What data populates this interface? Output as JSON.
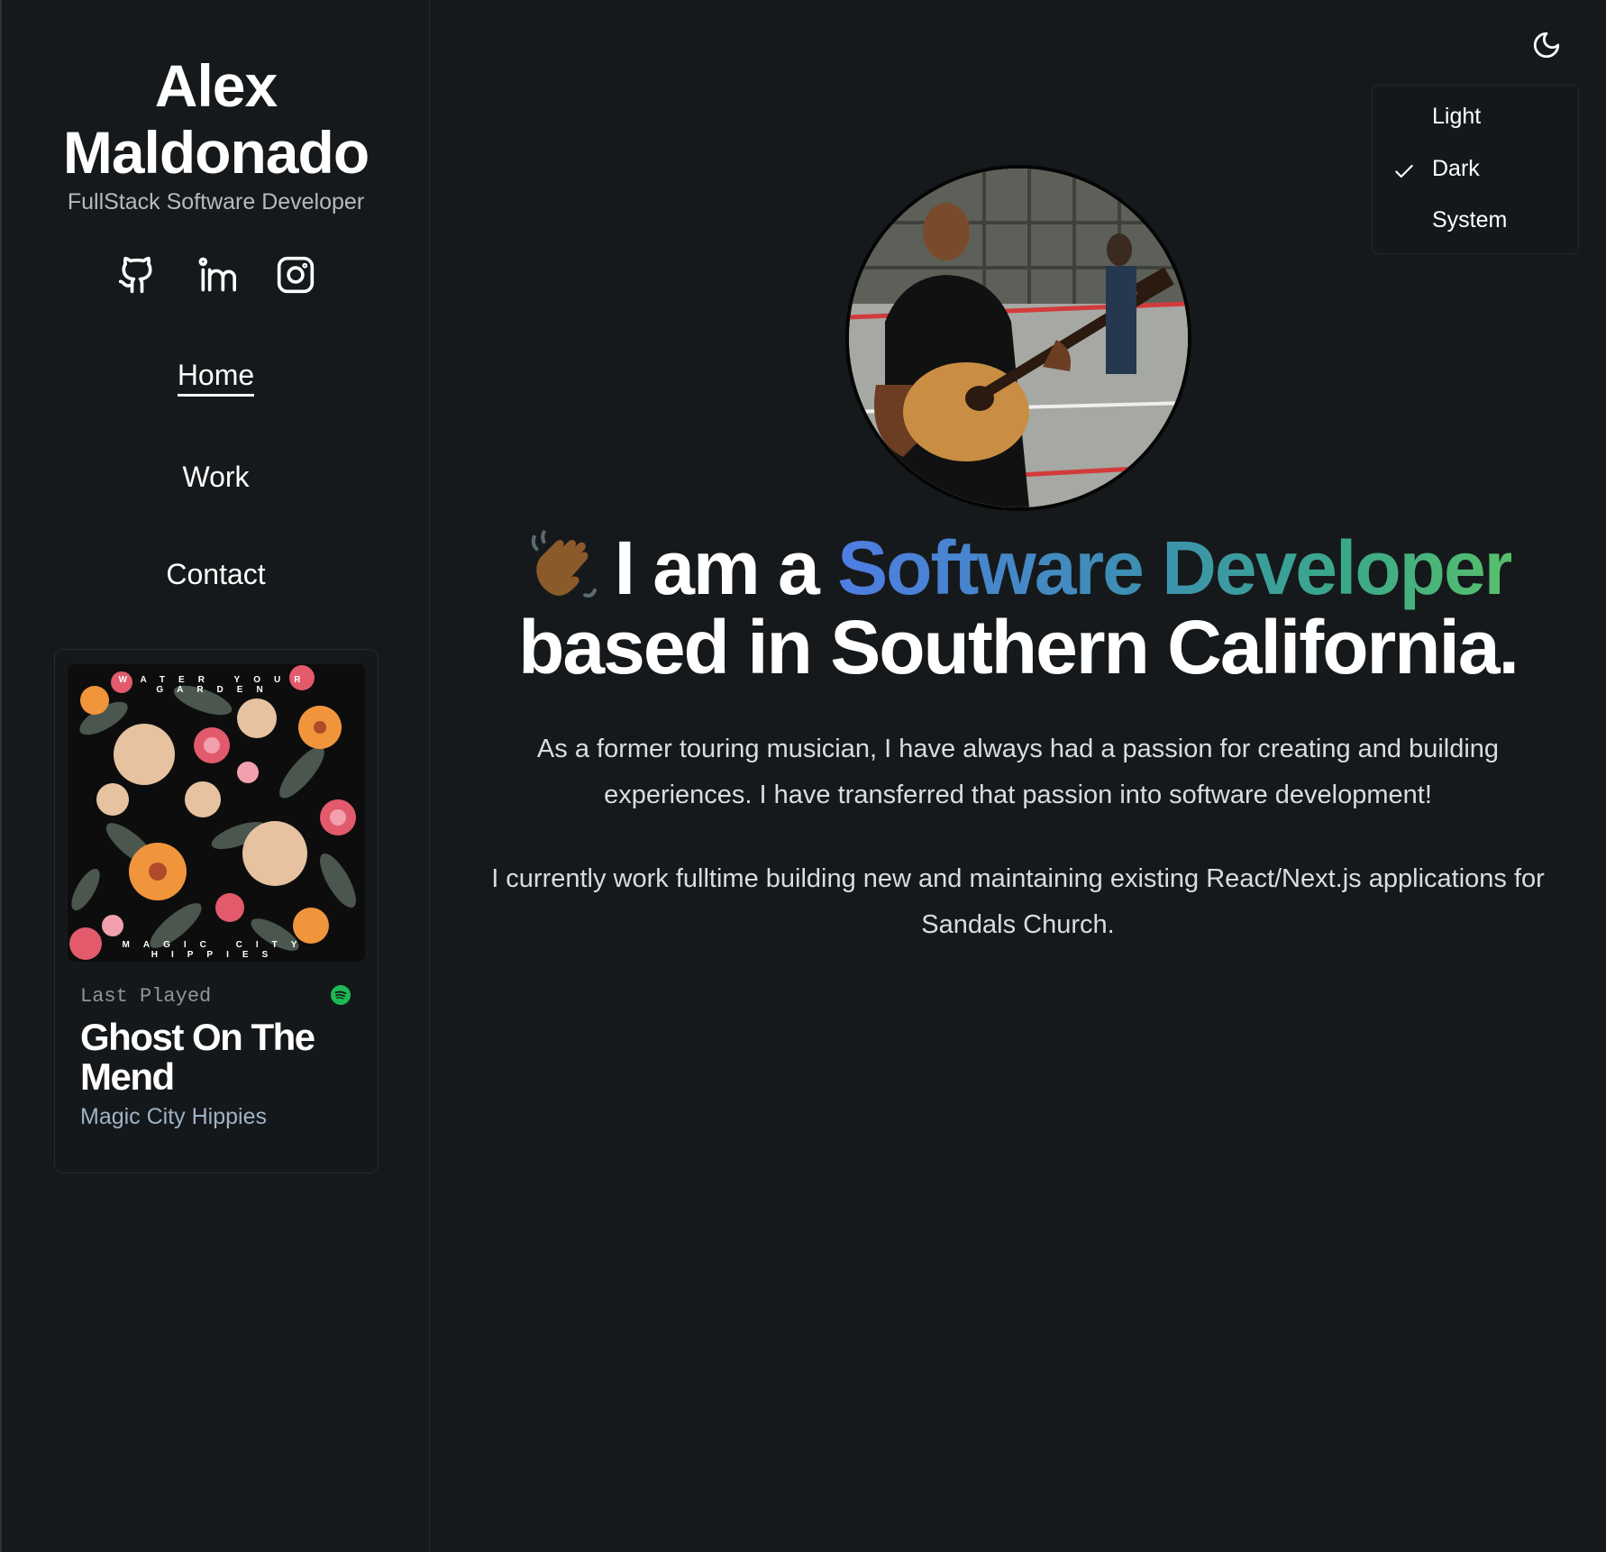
{
  "profile": {
    "name_line1": "Alex",
    "name_line2": "Maldonado",
    "subtitle": "FullStack Software Developer"
  },
  "socials": [
    {
      "icon": "github-icon"
    },
    {
      "icon": "linkedin-icon"
    },
    {
      "icon": "instagram-icon"
    }
  ],
  "nav": {
    "items": [
      {
        "label": "Home",
        "active": true
      },
      {
        "label": "Work",
        "active": false
      },
      {
        "label": "Contact",
        "active": false
      }
    ]
  },
  "now_playing": {
    "label": "Last Played",
    "service_icon": "spotify-icon",
    "title": "Ghost On The Mend",
    "artist": "Magic City Hippies",
    "album_art_text_top": "WATER YOUR GARDEN",
    "album_art_text_bottom": "MAGIC CITY HIPPIES"
  },
  "theme": {
    "toggle_icon": "moon-icon",
    "options": [
      {
        "label": "Light",
        "selected": false
      },
      {
        "label": "Dark",
        "selected": true
      },
      {
        "label": "System",
        "selected": false
      }
    ]
  },
  "hero": {
    "emoji": "waving-hand-icon",
    "headline_prefix": "I am a",
    "headline_highlight": "Software Developer",
    "headline_suffix": "based in Southern California.",
    "paragraph1": "As a former touring musician, I have always had a passion for creating and building experiences. I have transferred that passion into software development!",
    "paragraph2": "I currently work fulltime building new and maintaining existing React/Next.js applications for Sandals Church."
  },
  "colors": {
    "background": "#16191b",
    "gradient_start": "#4f7de3",
    "gradient_end": "#58c06b",
    "spotify_green": "#1db954"
  }
}
